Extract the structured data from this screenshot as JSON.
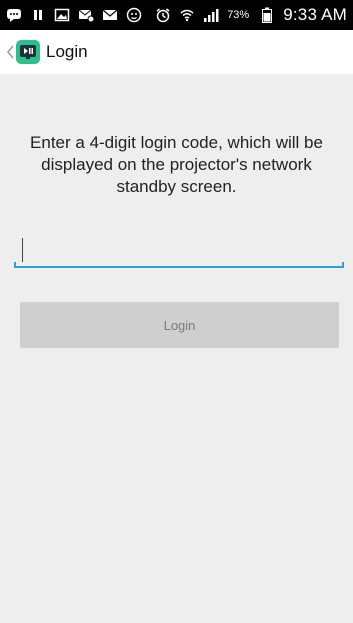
{
  "status_bar": {
    "icons": [
      "chat-bubble-icon",
      "pause-icon",
      "picture-icon",
      "mail-settings-icon",
      "mail-icon",
      "cat-face-icon",
      "alarm-icon",
      "wifi-icon",
      "signal-icon",
      "battery-icon"
    ],
    "battery_percent": "73%",
    "time": "9:33 AM"
  },
  "action_bar": {
    "title": "Login",
    "icons": {
      "back": "chevron-left-icon",
      "app": "app-icon"
    }
  },
  "main": {
    "instruction": "Enter a 4-digit login code, which will be displayed on the projector's network standby screen.",
    "code_input": {
      "value": "",
      "placeholder": ""
    },
    "login_button_label": "Login"
  },
  "colors": {
    "status_bar_bg": "#000000",
    "content_bg": "#eeeeee",
    "accent": "#2aa3dd",
    "button_bg": "#cfcfcf",
    "button_text": "#7b7b7b",
    "app_icon_bg": "#2bbf8a"
  }
}
